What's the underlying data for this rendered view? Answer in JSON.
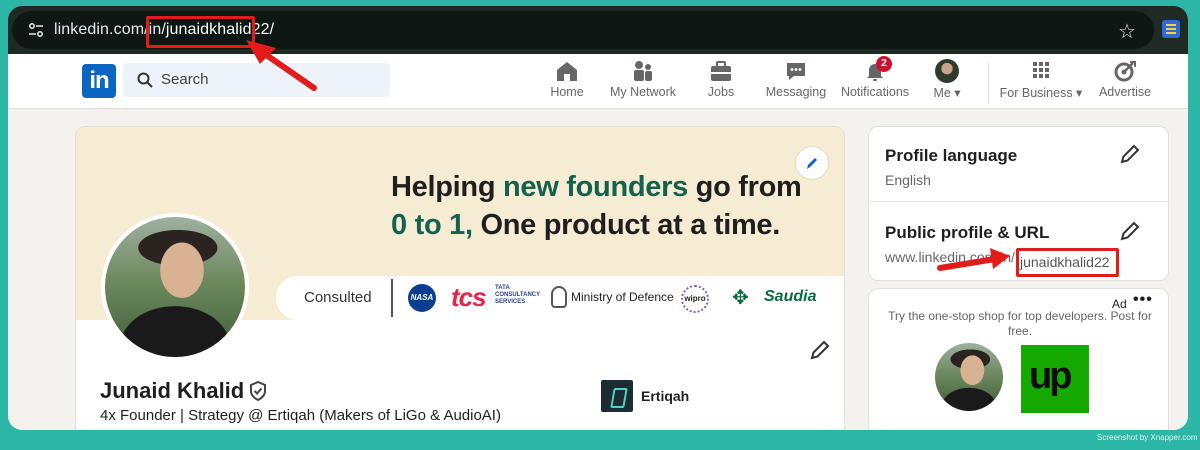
{
  "browser": {
    "url_host": "linkedin.com/in/",
    "url_path": "junaidkhalid22/",
    "icons": [
      "site-info-icon",
      "star-icon",
      "extension-icon"
    ]
  },
  "nav": {
    "logo": "in",
    "search_placeholder": "Search",
    "items": [
      {
        "label": "Home",
        "icon": "home-icon"
      },
      {
        "label": "My Network",
        "icon": "network-icon"
      },
      {
        "label": "Jobs",
        "icon": "briefcase-icon"
      },
      {
        "label": "Messaging",
        "icon": "chat-icon"
      },
      {
        "label": "Notifications",
        "icon": "bell-icon",
        "badge": "2"
      },
      {
        "label": "Me ▾",
        "icon": "avatar"
      },
      {
        "label": "For Business ▾",
        "icon": "grid-icon"
      },
      {
        "label": "Advertise",
        "icon": "advertise-icon"
      }
    ]
  },
  "profile": {
    "banner": {
      "headline_line1_pre": "Helping ",
      "headline_line1_accent": "new founders",
      "headline_line1_post": " go from",
      "headline_line2_accent": "0 to 1,",
      "headline_line2_post": " One product at a time.",
      "consulted_label": "Consulted",
      "logos": {
        "nasa": "NASA",
        "tcs": "tcs",
        "tcs_sub": "TATA CONSULTANCY SERVICES",
        "mod": "Ministry of Defence",
        "wipro": "wipro",
        "saudia": "Saudia"
      }
    },
    "name": "Junaid Khalid",
    "tagline": "4x Founder | Strategy @ Ertiqah (Makers of LiGo & AudioAI)",
    "company": "Ertiqah"
  },
  "sidebar": {
    "profile_language": {
      "title": "Profile language",
      "value": "English"
    },
    "public_profile": {
      "title": "Public profile & URL",
      "url_prefix": "www.linkedin.com/in/",
      "url_slug": "junaidkhalid22"
    },
    "ad": {
      "label": "Ad",
      "more": "•••",
      "text": "Try the one-stop shop for top developers. Post for free.",
      "brand": "up"
    }
  },
  "watermark": "Screenshot by Xnapper.com",
  "colors": {
    "linkedin_blue": "#0a66c2",
    "accent_green": "#14614e",
    "highlight_red": "#e21b1b",
    "upwork_green": "#14a800",
    "background_teal": "#2cb6a6"
  }
}
